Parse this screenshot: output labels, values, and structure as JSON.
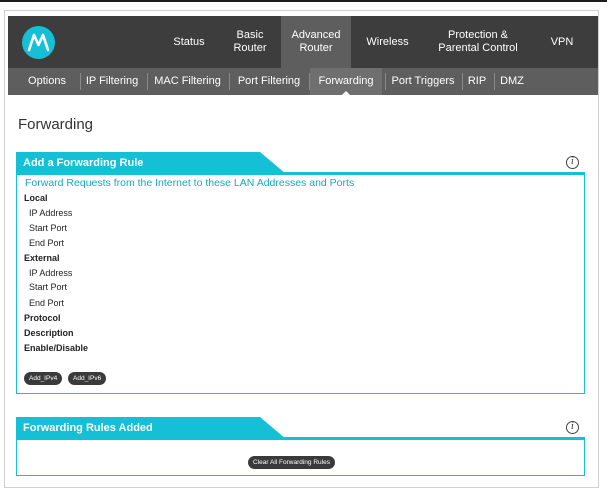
{
  "nav": {
    "status": "Status",
    "basic_l1": "Basic",
    "basic_l2": "Router",
    "advanced_l1": "Advanced",
    "advanced_l2": "Router",
    "wireless": "Wireless",
    "protection_l1": "Protection &",
    "protection_l2": "Parental Control",
    "vpn": "VPN"
  },
  "subnav": {
    "options": "Options",
    "ip_filtering": "IP Filtering",
    "mac_filtering": "MAC Filtering",
    "port_filtering": "Port Filtering",
    "forwarding": "Forwarding",
    "port_triggers": "Port Triggers",
    "rip": "RIP",
    "dmz": "DMZ"
  },
  "page_title": "Forwarding",
  "add_rule": {
    "tab": "Add a Forwarding Rule",
    "heading": "Forward Requests from the Internet to these LAN Addresses and Ports",
    "local": "Local",
    "local_ip": "IP Address",
    "local_start": "Start Port",
    "local_end": "End Port",
    "external": "External",
    "external_ip": "IP Address",
    "external_start": "Start Port",
    "external_end": "End Port",
    "protocol": "Protocol",
    "description": "Description",
    "enable": "Enable/Disable",
    "add_ipv4": "Add_IPv4",
    "add_ipv6": "Add_IPv6"
  },
  "rules_added": {
    "tab": "Forwarding Rules Added",
    "clear_all": "Clear All Forwarding Rules"
  },
  "icons": {
    "logo": "motorola-logo",
    "info": "info-icon"
  },
  "colors": {
    "accent": "#15bfd6",
    "nav_bg": "#3d3d3d",
    "subnav_bg": "#5e5e5e"
  }
}
